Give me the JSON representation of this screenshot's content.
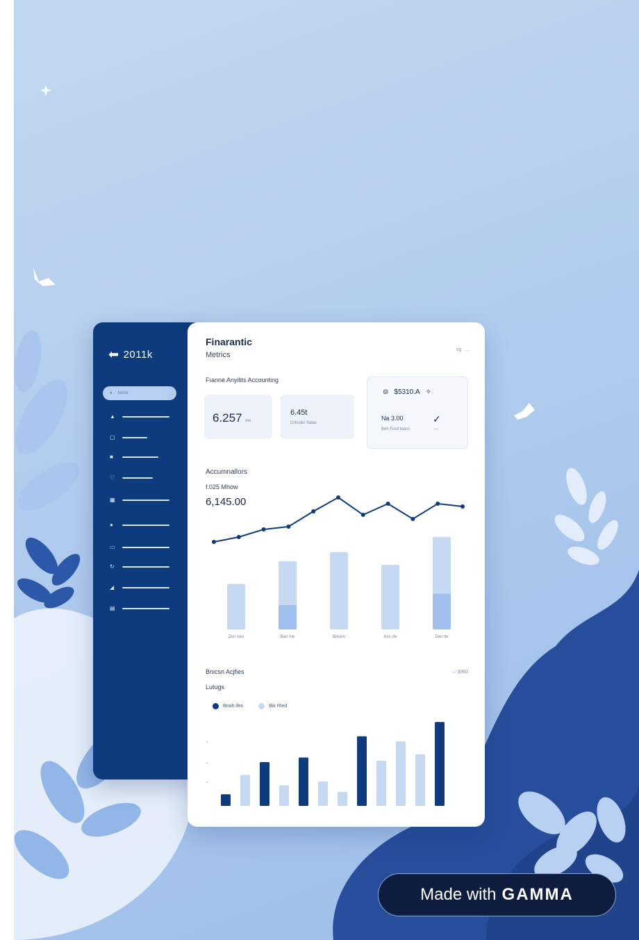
{
  "sidebar": {
    "logo_text": "2011k",
    "active_label": "home",
    "items": [
      {
        "icon": "home-icon"
      },
      {
        "icon": "wallet-icon"
      },
      {
        "icon": "folder-icon"
      },
      {
        "icon": "shield-icon"
      },
      {
        "icon": "grid-icon"
      },
      {
        "icon": "user-icon"
      },
      {
        "icon": "calendar-icon"
      },
      {
        "icon": "refresh-icon"
      },
      {
        "icon": "chart-icon"
      },
      {
        "icon": "settings-icon"
      }
    ]
  },
  "header": {
    "title": "Finarantic",
    "subtitle": "Metrics",
    "controls": [
      "vg",
      "..."
    ]
  },
  "section_label": "Fıanne Anyilits Accounting",
  "stats": [
    {
      "value": "6.257",
      "unit": "ms"
    },
    {
      "value": "6.45t",
      "sub": "Grtsuler Salas"
    },
    {
      "value": "$5310.A",
      "label": "Na 3.00",
      "sub": "Beh Fusll teans"
    }
  ],
  "accumulators": {
    "title": "Accumnallors",
    "small": "f.025 Mhow",
    "value": "6,145.00"
  },
  "chart_data": [
    {
      "type": "line",
      "title": "Accumnallors",
      "series": [
        {
          "values": [
            34,
            41,
            52,
            56,
            78,
            98,
            73,
            89,
            67,
            89,
            85
          ]
        }
      ],
      "ylim": [
        0,
        110
      ]
    },
    {
      "type": "bar",
      "categories": [
        "Zen tren",
        "Ban nle",
        "Brearn",
        "Asn rte",
        "Den tle"
      ],
      "series": [
        {
          "name": "upper",
          "values": [
            60,
            90,
            102,
            85,
            122
          ]
        },
        {
          "name": "lower",
          "values": [
            0,
            32,
            0,
            0,
            47
          ]
        }
      ],
      "ylim": [
        0,
        130
      ]
    },
    {
      "type": "bar",
      "title": "Bnicsn Acjfies",
      "series": [
        {
          "name": "Bnah ifes",
          "color": "#0e3a7e",
          "values": [
            18,
            0,
            68,
            0,
            75,
            0,
            0,
            108,
            0,
            0,
            0,
            130
          ]
        },
        {
          "name": "Bik Rled",
          "color": "#c6d9f3",
          "values": [
            0,
            48,
            0,
            32,
            0,
            38,
            22,
            0,
            70,
            100,
            80,
            0
          ]
        }
      ],
      "ylim": [
        0,
        140
      ]
    }
  ],
  "budget": {
    "title": "Bnicsn Acjfies",
    "right": "→ 3360",
    "sub": "Lutugs"
  },
  "badge": {
    "made": "Made with",
    "brand": "GAMMA"
  },
  "colors": {
    "navy": "#0e3a7e",
    "light_blue": "#c6d9f3",
    "badge_bg": "#0d1c3f"
  }
}
